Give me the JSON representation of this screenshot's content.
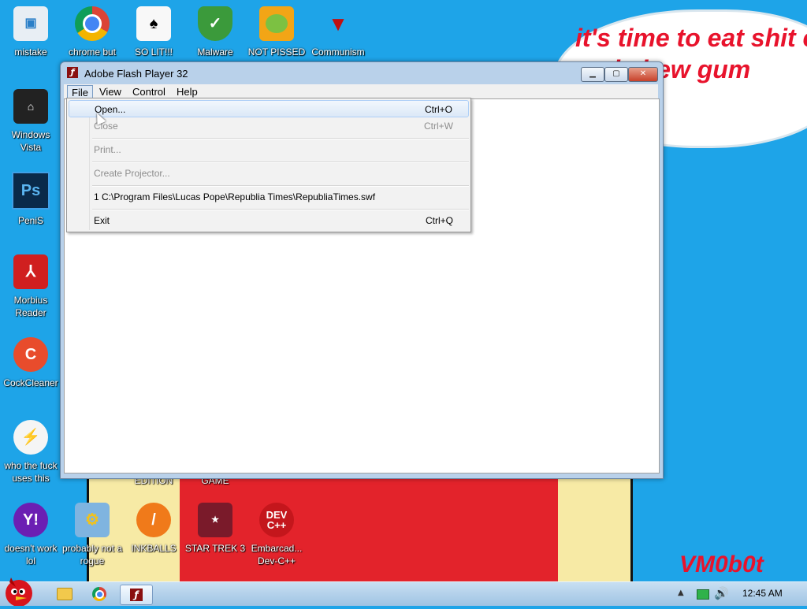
{
  "wallpaper": {
    "bubble_text": "it's time to eat shit e and chew gum",
    "signature": "VM0b0t"
  },
  "desktop_icons": [
    {
      "label": "mistake"
    },
    {
      "label": "chrome but"
    },
    {
      "label": "SO LIT!!!"
    },
    {
      "label": "Malware"
    },
    {
      "label": "NOT PISSED"
    },
    {
      "label": "Communism"
    },
    {
      "label": "Windows Vista"
    },
    {
      "label": "PeniS"
    },
    {
      "label": "Morbius Reader"
    },
    {
      "label": "CockCleaner"
    },
    {
      "label": "who the fuck uses this"
    },
    {
      "label": "doesn't work lol"
    },
    {
      "label": "probably not a rogue"
    },
    {
      "label": "INKBALLS"
    },
    {
      "label": "STAR TREK 3"
    },
    {
      "label": "Embarcad... Dev-C++"
    },
    {
      "label": "EDITION"
    },
    {
      "label": "GAME"
    }
  ],
  "window": {
    "title": "Adobe Flash Player 32",
    "menu": [
      "File",
      "View",
      "Control",
      "Help"
    ]
  },
  "file_menu": {
    "items": [
      {
        "label": "Open...",
        "accel": "Ctrl+O"
      },
      {
        "label": "Close",
        "accel": "Ctrl+W"
      },
      {
        "label": "Print...",
        "accel": ""
      },
      {
        "label": "Create Projector...",
        "accel": ""
      },
      {
        "label": "1 C:\\Program Files\\Lucas Pope\\Republia Times\\RepubliaTimes.swf",
        "accel": ""
      },
      {
        "label": "Exit",
        "accel": "Ctrl+Q"
      }
    ]
  },
  "taskbar": {
    "clock": "12:45 AM"
  },
  "colors": {
    "desktop": "#1ea4e8",
    "wallpaper_red": "#e3232b",
    "wallpaper_cream": "#f7eaa5"
  }
}
